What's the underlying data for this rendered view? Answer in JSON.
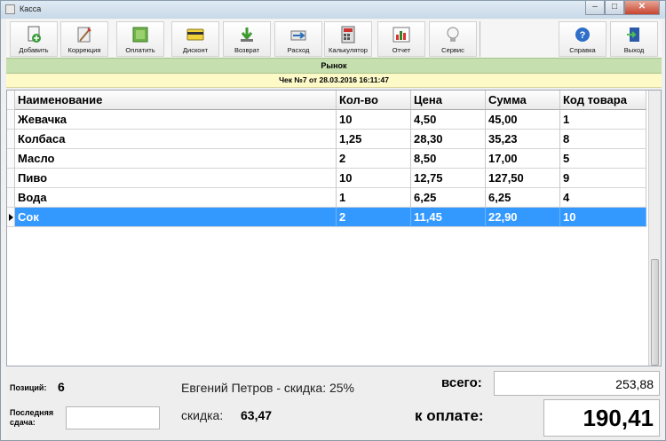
{
  "window": {
    "title": "Касса",
    "minimize": "–",
    "maximize": "□",
    "close": "✕"
  },
  "toolbar": {
    "buttons": [
      {
        "label": "Добавить",
        "icon": "add-document-icon"
      },
      {
        "label": "Коррекция",
        "icon": "correction-icon"
      },
      {
        "label": "Оплатить",
        "icon": "pay-icon"
      },
      {
        "label": "Дисконт",
        "icon": "discount-card-icon"
      },
      {
        "label": "Возврат",
        "icon": "return-arrow-icon"
      },
      {
        "label": "Расход",
        "icon": "expense-icon"
      },
      {
        "label": "Калькулятор",
        "icon": "calculator-icon"
      },
      {
        "label": "Отчет",
        "icon": "report-chart-icon"
      },
      {
        "label": "Сервис",
        "icon": "lightbulb-icon"
      },
      {
        "label": "Справка",
        "icon": "help-icon"
      },
      {
        "label": "Выход",
        "icon": "exit-icon"
      }
    ]
  },
  "shop_name": "Рынок",
  "check_title": "Чек №7 от 28.03.2016 16:11:47",
  "table": {
    "columns": [
      "Наименование",
      "Кол-во",
      "Цена",
      "Сумма",
      "Код товара"
    ],
    "rows": [
      [
        "Жевачка",
        "10",
        "4,50",
        "45,00",
        "1"
      ],
      [
        "Колбаса",
        "1,25",
        "28,30",
        "35,23",
        "8"
      ],
      [
        "Масло",
        "2",
        "8,50",
        "17,00",
        "5"
      ],
      [
        "Пиво",
        "10",
        "12,75",
        "127,50",
        "9"
      ],
      [
        "Вода",
        "1",
        "6,25",
        "6,25",
        "4"
      ],
      [
        "Сок",
        "2",
        "11,45",
        "22,90",
        "10"
      ]
    ],
    "selected_row": 5
  },
  "footer": {
    "positions_label": "Позиций:",
    "positions_value": "6",
    "last_change_label": "Последняя сдача:",
    "customer_discount": "Евгений Петров - скидка: 25%",
    "discount_label": "скидка:",
    "discount_value": "63,47",
    "total_label": "всего:",
    "total_value": "253,88",
    "to_pay_label": "к оплате:",
    "to_pay_value": "190,41"
  },
  "colors": {
    "selection": "#3399ff",
    "shop_band": "#c6dfae",
    "check_band": "#fdfac8"
  }
}
